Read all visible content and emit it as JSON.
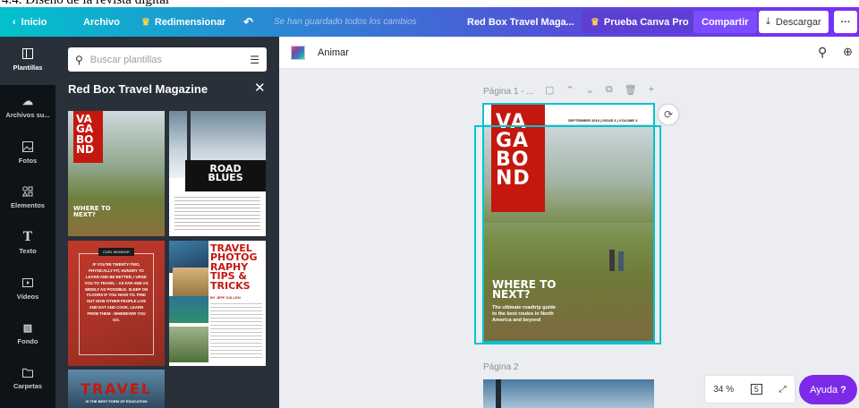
{
  "caption": "4.4. Diseño de la revista digital",
  "topbar": {
    "back": "Inicio",
    "file": "Archivo",
    "resize": "Redimensionar",
    "undo_icon": "undo-icon",
    "status": "Se han guardado todos los cambios",
    "doc_title": "Red Box Travel Maga...",
    "pro": "Prueba Canva Pro",
    "share": "Compartir",
    "download": "Descargar",
    "more": "···"
  },
  "sidebar": {
    "items": [
      {
        "label": "Plantillas",
        "icon": "layout-icon"
      },
      {
        "label": "Archivos su...",
        "icon": "cloud-upload-icon"
      },
      {
        "label": "Fotos",
        "icon": "photo-icon"
      },
      {
        "label": "Elementos",
        "icon": "shapes-icon"
      },
      {
        "label": "Texto",
        "icon": "text-icon"
      },
      {
        "label": "Vídeos",
        "icon": "video-icon"
      },
      {
        "label": "Fondo",
        "icon": "background-icon"
      },
      {
        "label": "Carpetas",
        "icon": "folder-icon"
      }
    ]
  },
  "panel": {
    "search_placeholder": "Buscar plantillas",
    "title": "Red Box Travel Magazine"
  },
  "thumbs": {
    "t1": {
      "vag": "VA\nGA\nBO\nND",
      "where": "WHERE TO\nNEXT?"
    },
    "t2": {
      "road": "ROAD\nBLUES"
    },
    "t3": {
      "tag": "CARL MONROE",
      "body": "IF YOU'RE TWENTY-TWO, PHYSICALLY FIT, HUNGRY TO LEARN AND BE BETTER, I URGE YOU TO TRAVEL - AS FAR AND AS WIDELY AS POSSIBLE. SLEEP ON FLOORS IF YOU HAVE TO. FIND OUT HOW OTHER PEOPLE LIVE AND EAT AND COOK. LEARN FROM THEM - WHEREVER YOU GO."
    },
    "t4": {
      "title": "TRAVEL\nPHOTOG\nRAPHY\nTIPS &\nTRICKS",
      "by": "BY JEFF CULLEN"
    },
    "t5": {
      "title": "TRAVEL",
      "sub": "IS THE BEST FORM OF EDUCATION"
    }
  },
  "toolbar": {
    "animate": "Animar"
  },
  "page1": {
    "label": "Página 1 - ...",
    "vag": "VA\nGA\nBO\nND",
    "date": "SEPTEMBER 2019  |  ISSUE 6  |  VOLUME 3",
    "where": "WHERE TO\nNEXT?",
    "sub": "The ultimate roadtrip guide\nto the best routes in North\nAmerica and beyond"
  },
  "page2": {
    "label": "Página 2"
  },
  "zoom": {
    "value": "34 %",
    "pages": "5"
  },
  "help": {
    "label": "Ayuda",
    "mark": "?"
  },
  "colors": {
    "red": "#c4180e",
    "accent": "#00c4cc",
    "purple": "#7d2ae8"
  }
}
